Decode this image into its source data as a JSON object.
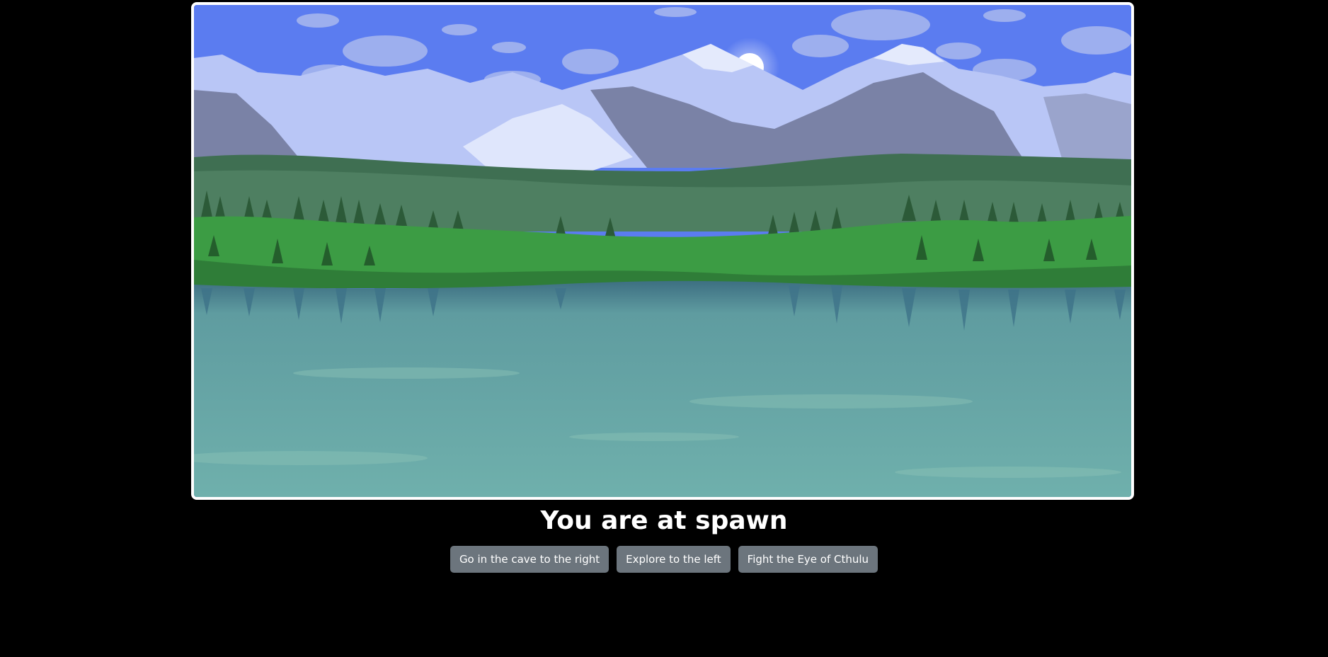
{
  "scene": {
    "image_name": "spawn-landscape",
    "colors": {
      "sky": "#5b7cf0",
      "mountain_snow": "#c9d4fb",
      "mountain_shadow": "#7a82a6",
      "forest": "#3f6f52",
      "grass": "#3c9c44",
      "lake": "#6fb0ac",
      "sun": "#ffffff"
    }
  },
  "location": {
    "title": "You are at spawn"
  },
  "choices": [
    {
      "label": "Go in the cave to the right"
    },
    {
      "label": "Explore to the left"
    },
    {
      "label": "Fight the Eye of Cthulu"
    }
  ]
}
